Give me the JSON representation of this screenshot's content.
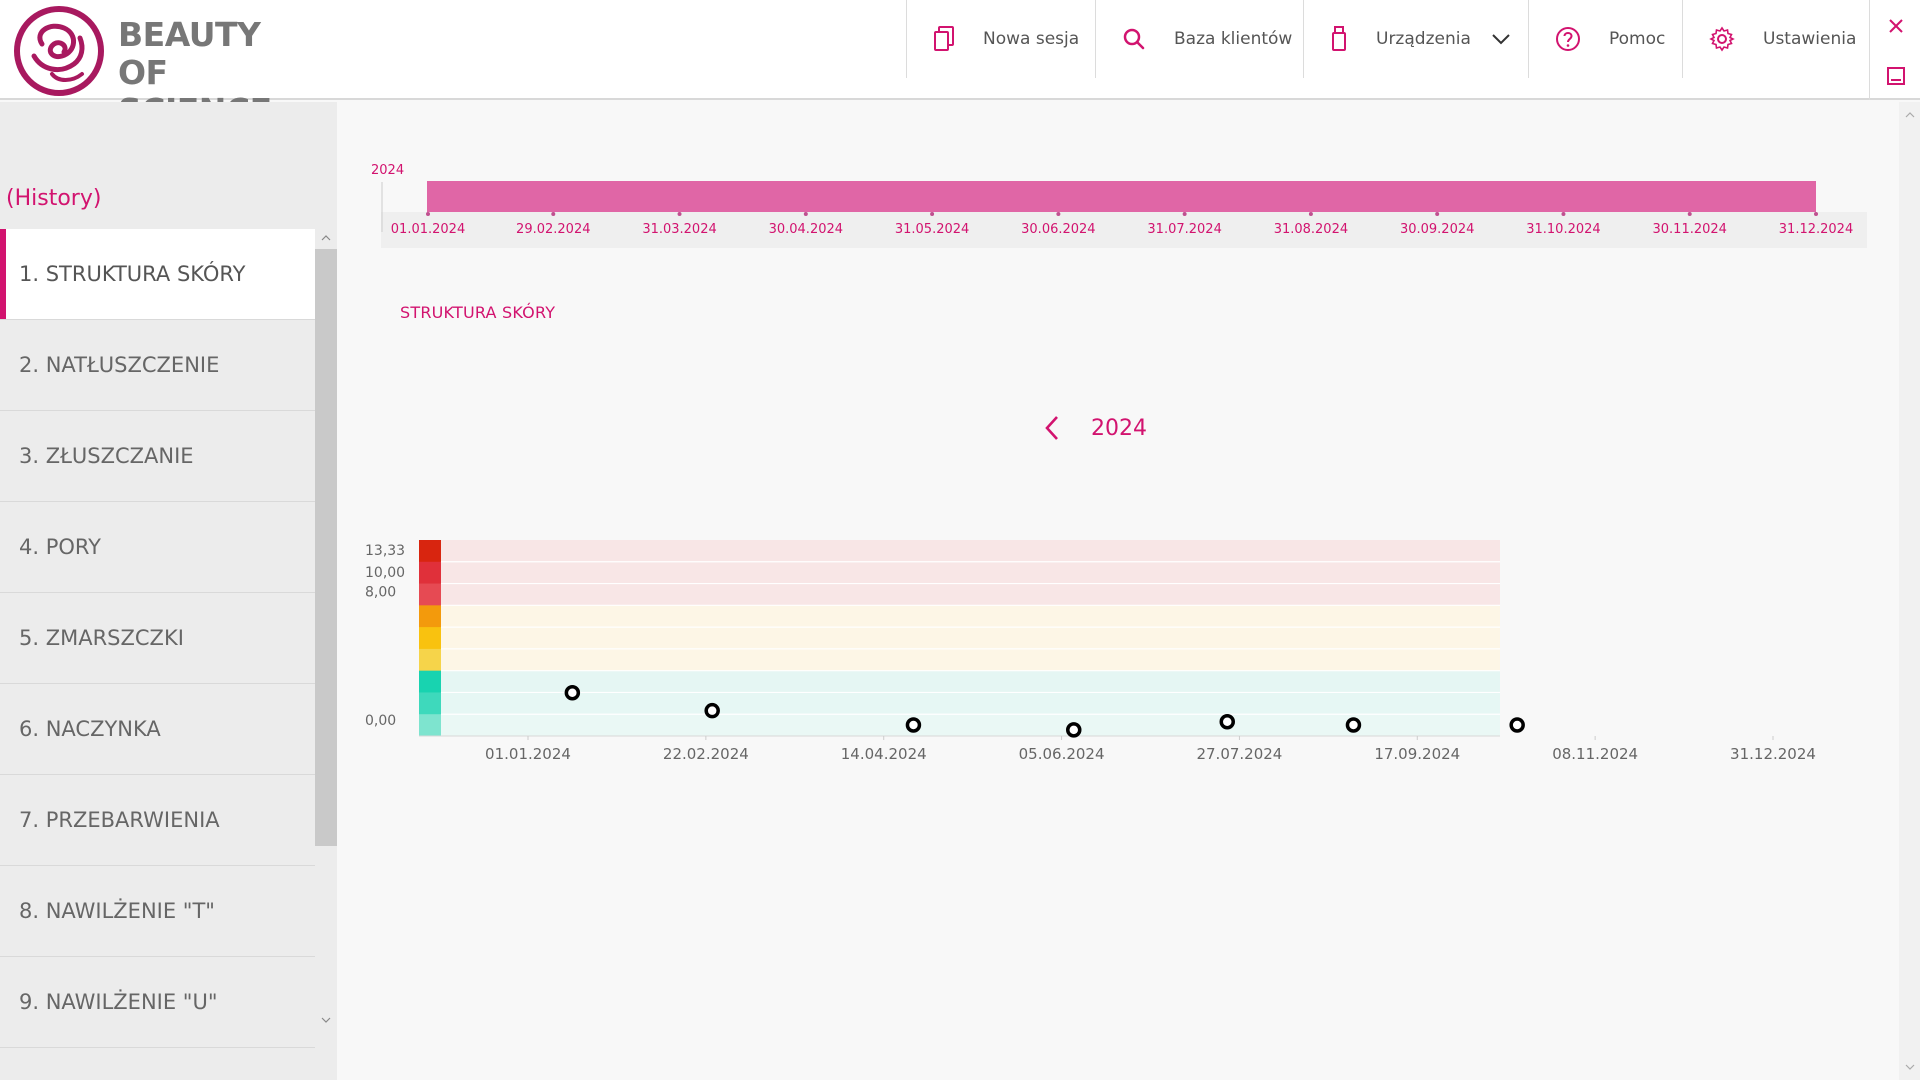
{
  "brand": {
    "line1": "BEAUTY",
    "line2": "OF SCIENCE",
    "accent_color": "#d2136f"
  },
  "nav": {
    "items": [
      {
        "label": "Nowa sesja",
        "icon": "document-copy-icon"
      },
      {
        "label": "Baza klientów",
        "icon": "search-icon"
      },
      {
        "label": "Urządzenia",
        "icon": "usb-device-icon",
        "has_dropdown": true
      },
      {
        "label": "Pomoc",
        "icon": "help-circle-icon"
      },
      {
        "label": "Ustawienia",
        "icon": "gear-icon"
      }
    ]
  },
  "window_controls": {
    "close_icon": "close-icon",
    "minimize_icon": "minimize-icon"
  },
  "sidebar": {
    "history_label": "(History)",
    "items": [
      {
        "label": "1. STRUKTURA SKÓRY",
        "active": true
      },
      {
        "label": "2. NATŁUSZCZENIE",
        "active": false
      },
      {
        "label": "3. ZŁUSZCZANIE",
        "active": false
      },
      {
        "label": "4. PORY",
        "active": false
      },
      {
        "label": "5. ZMARSZCZKI",
        "active": false
      },
      {
        "label": "6. NACZYNKA",
        "active": false
      },
      {
        "label": "7. PRZEBARWIENIA",
        "active": false
      },
      {
        "label": "8. NAWILŻENIE \"T\"",
        "active": false
      },
      {
        "label": "9. NAWILŻENIE \"U\"",
        "active": false
      }
    ]
  },
  "timeline": {
    "year_label": "2024",
    "ticks": [
      "01.01.2024",
      "29.02.2024",
      "31.03.2024",
      "30.04.2024",
      "31.05.2024",
      "30.06.2024",
      "31.07.2024",
      "31.08.2024",
      "30.09.2024",
      "31.10.2024",
      "30.11.2024",
      "31.12.2024"
    ],
    "range_color": "#e066a6"
  },
  "chart": {
    "title": "STRUKTURA SKÓRY",
    "year": "2024"
  },
  "chart_data": {
    "type": "scatter",
    "title": "",
    "xlabel": "",
    "ylabel": "",
    "x_ticks": [
      "01.01.2024",
      "22.02.2024",
      "14.04.2024",
      "05.06.2024",
      "27.07.2024",
      "17.09.2024",
      "08.11.2024",
      "31.12.2024"
    ],
    "y_ticks": [
      "0,00",
      "8,00",
      "10,00",
      "13,33"
    ],
    "points": [
      {
        "x": "2024-01-14",
        "y": 5.3
      },
      {
        "x": "2024-02-24",
        "y": 3.1
      },
      {
        "x": "2024-04-23",
        "y": 1.35
      },
      {
        "x": "2024-06-09",
        "y": 0.75
      },
      {
        "x": "2024-07-24",
        "y": 1.75
      },
      {
        "x": "2024-08-30",
        "y": 1.35
      },
      {
        "x": "2024-10-17",
        "y": 1.35
      }
    ],
    "bands": [
      {
        "color": "#d8250f",
        "bg": "#f8e6e6"
      },
      {
        "color": "#e0303a",
        "bg": "#f8e6e6"
      },
      {
        "color": "#e64a53",
        "bg": "#f8e6e6"
      },
      {
        "color": "#f39a0c",
        "bg": "#fdf6e6"
      },
      {
        "color": "#f9c20f",
        "bg": "#fdf6e6"
      },
      {
        "color": "#f6d44a",
        "bg": "#fdf6e6"
      },
      {
        "color": "#18d3b0",
        "bg": "#e5f6f3"
      },
      {
        "color": "#3ed9bc",
        "bg": "#e6f7f4"
      },
      {
        "color": "#7ee4cf",
        "bg": "#eaf8f5"
      }
    ],
    "grid": true
  }
}
